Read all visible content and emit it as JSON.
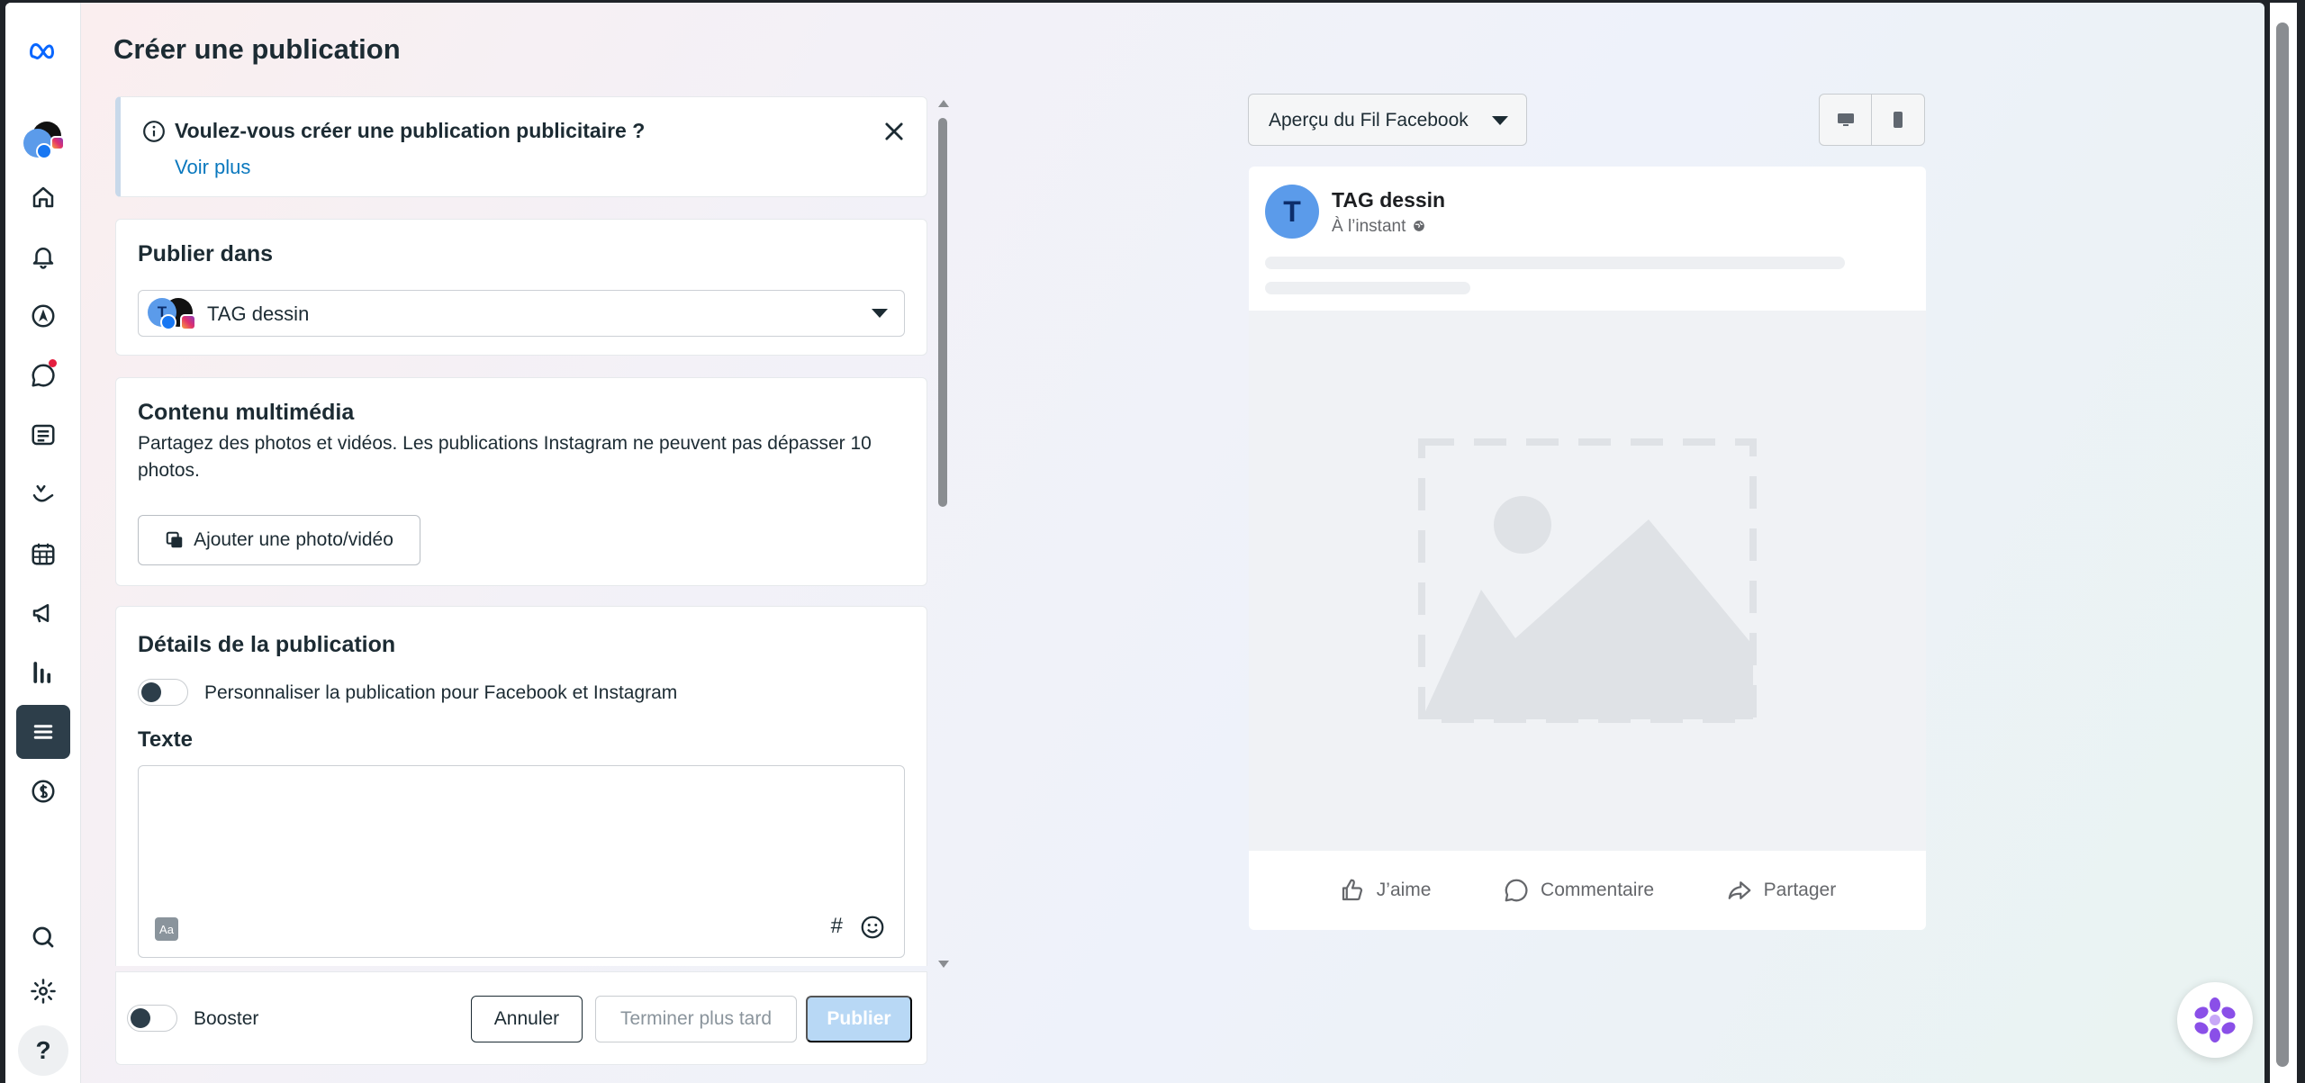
{
  "page": {
    "title": "Créer une publication"
  },
  "info_banner": {
    "title": "Voulez-vous créer une publication publicitaire ?",
    "link": "Voir plus"
  },
  "publish_in": {
    "title": "Publier dans",
    "selected_account": "TAG dessin",
    "avatar_letter": "T"
  },
  "media": {
    "title": "Contenu multimédia",
    "description": "Partagez des photos et vidéos. Les publications Instagram ne peuvent pas dépasser 10 photos.",
    "add_button": "Ajouter une photo/vidéo"
  },
  "details": {
    "title": "Détails de la publication",
    "customize_label": "Personnaliser la publication pour Facebook et Instagram",
    "text_label": "Texte",
    "hashtag_symbol": "#"
  },
  "footer": {
    "boost_label": "Booster",
    "cancel": "Annuler",
    "later": "Terminer plus tard",
    "publish": "Publier"
  },
  "preview": {
    "dropdown_label": "Aperçu du Fil Facebook",
    "page_name": "TAG dessin",
    "time": "À l’instant",
    "avatar_letter": "T",
    "actions": {
      "like": "J’aime",
      "comment": "Commentaire",
      "share": "Partager"
    }
  },
  "colors": {
    "brand_blue": "#0a78be",
    "dark_nav": "#2d3e4a",
    "publish_disabled": "#b8d8f5",
    "notification": "#e41e3f"
  },
  "icons": {
    "rail": [
      "meta-logo-icon",
      "profile-avatar",
      "home-icon",
      "bell-icon",
      "compass-icon",
      "chat-icon",
      "content-icon",
      "planner-icon",
      "calendar-icon",
      "megaphone-icon",
      "insights-icon",
      "menu-icon",
      "dollar-icon",
      "search-icon",
      "gear-icon",
      "help-icon"
    ]
  }
}
